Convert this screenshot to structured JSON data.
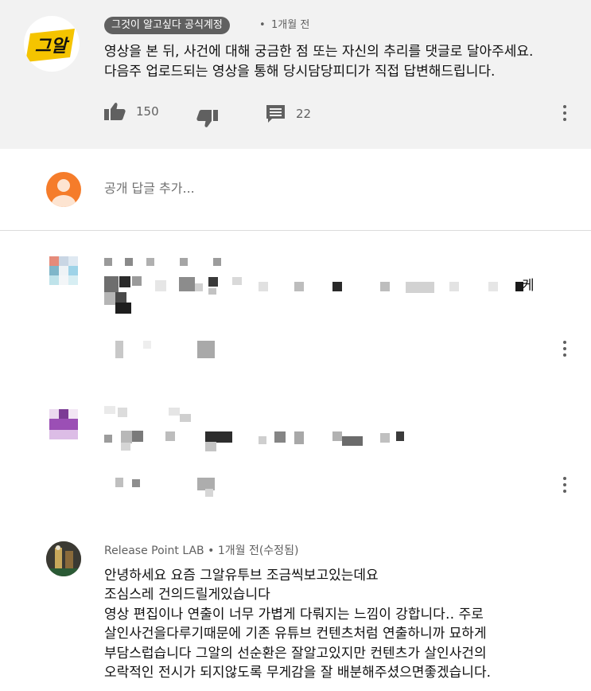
{
  "pinned_comment": {
    "author_badge": "그것이 알고싶다 공식계정",
    "time": "1개월 전",
    "logo_text": "그알",
    "lines": [
      "영상을 본 뒤, 사건에 대해 궁금한 점 또는 자신의 추리를 댓글로 달아주세요.",
      "다음주 업로드되는 영상을 통해 당시담당피디가 직접 답변해드립니다."
    ],
    "like_count": "150",
    "reply_count": "22"
  },
  "reply_box": {
    "placeholder": "공개 답글 추가..."
  },
  "comment3": {
    "author": "Release Point LAB",
    "time": "1개월 전(수정됨)",
    "lines": [
      "안녕하세요 요즘 그알유투브 조금씩보고있는데요",
      "조심스레 건의드릴게있습니다",
      "영상 편집이나 연출이 너무 가볍게 다뤄지는 느낌이 강합니다‥ 주로",
      "살인사건을다루기때문에 기존 유튜브 컨텐츠처럼 연출하니까 묘하게",
      "부담스럽습니다 그알의 선순환은 잘알고있지만 컨텐츠가 살인사건의",
      "오락적인 전시가 되지않도록 무게감을 잘 배분해주셨으면좋겠습니다."
    ]
  },
  "blurred_comments": {
    "first_line_tail": "케"
  },
  "colors": {
    "pinned_bg": "#f2f2f2",
    "badge_bg": "#606060",
    "logo_yellow": "#f5c400",
    "avatar_orange": "#f57c2a"
  },
  "icons": [
    "thumb-up-icon",
    "thumb-down-icon",
    "reply-icon",
    "more-vert-icon",
    "user-avatar-icon"
  ]
}
